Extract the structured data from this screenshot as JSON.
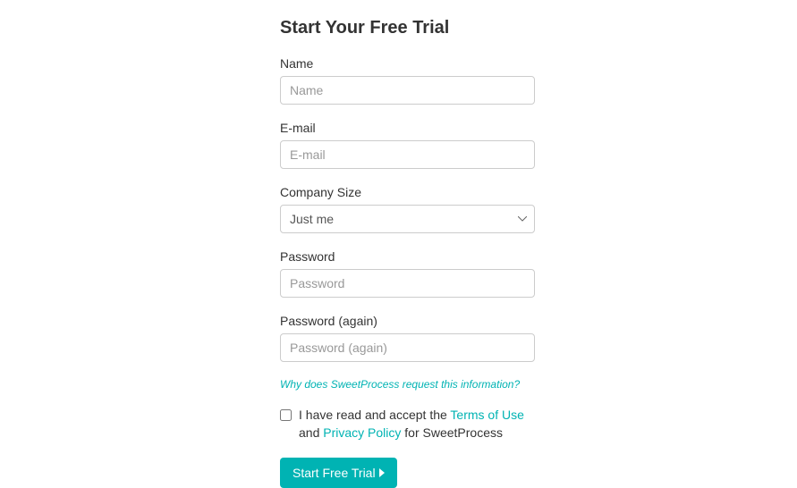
{
  "title": "Start Your Free Trial",
  "fields": {
    "name": {
      "label": "Name",
      "placeholder": "Name"
    },
    "email": {
      "label": "E-mail",
      "placeholder": "E-mail"
    },
    "company_size": {
      "label": "Company Size",
      "selected": "Just me"
    },
    "password": {
      "label": "Password",
      "placeholder": "Password"
    },
    "password_again": {
      "label": "Password (again)",
      "placeholder": "Password (again)"
    }
  },
  "info_link": "Why does SweetProcess request this information?",
  "terms": {
    "prefix": "I have read and accept the ",
    "terms_of_use": "Terms of Use",
    "and": " and ",
    "privacy_policy": "Privacy Policy",
    "suffix": " for SweetProcess"
  },
  "submit_label": "Start Free Trial"
}
